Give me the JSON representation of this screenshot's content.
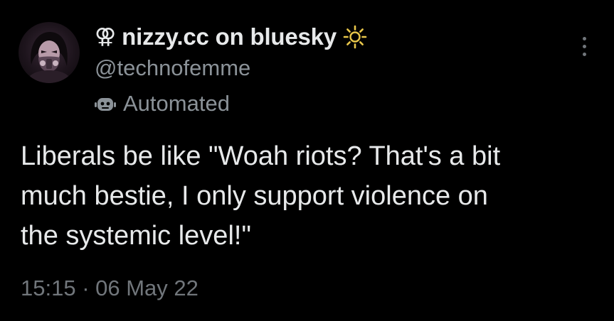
{
  "author": {
    "name_glyph": "⚢",
    "display_name": "nizzy.cc on bluesky",
    "handle": "@technofemme",
    "badge_icon": "sun-icon",
    "automated_label": "Automated",
    "automated_icon": "bot-icon",
    "avatar_icon": "avatar-masked-face"
  },
  "tweet": {
    "text": "Liberals be like \"Woah riots? That's a bit\nmuch bestie, I only support violence on\nthe systemic level!\"",
    "timestamp": "15:15 · 06 May 22"
  },
  "menu": {
    "icon": "more-vertical-icon"
  },
  "colors": {
    "background": "#000000",
    "primary_text": "#e7e9ea",
    "secondary_text": "#8b9298",
    "muted_text": "#71767b",
    "badge": "#e8c64a"
  }
}
